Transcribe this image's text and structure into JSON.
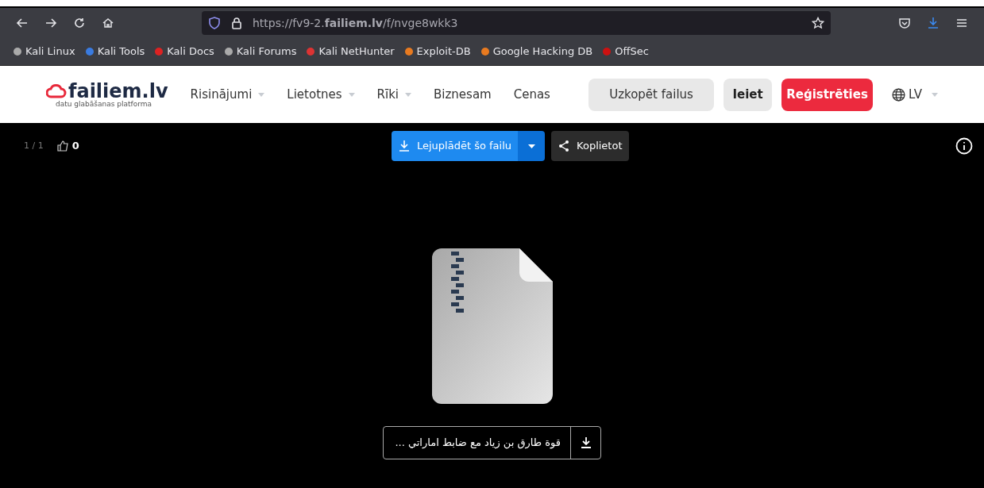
{
  "browser": {
    "url": "https://fv9-2.**failiem.lv**/f/nvge8wkk3",
    "bookmarks": [
      "Kali Linux",
      "Kali Tools",
      "Kali Docs",
      "Kali Forums",
      "Kali NetHunter",
      "Exploit-DB",
      "Google Hacking DB",
      "OffSec"
    ]
  },
  "site_header": {
    "logo": "failiem.lv",
    "tagline": "datu glabāšanas platforma",
    "nav": [
      {
        "label": "Risinājumi",
        "dropdown": true
      },
      {
        "label": "Lietotnes",
        "dropdown": true
      },
      {
        "label": "Rīki",
        "dropdown": true
      },
      {
        "label": "Biznesam",
        "dropdown": false
      },
      {
        "label": "Cenas",
        "dropdown": false
      }
    ],
    "copy_button": "Uzkopēt failus",
    "login_button": "Ieiet",
    "register_button": "Reģistrēties",
    "language": "LV"
  },
  "viewer": {
    "counter": "1 / 1",
    "likes": "0",
    "download_button": "Lejuplādēt šo failu",
    "share_button": "Koplietot",
    "file_name": "قوة طارق بن زياد مع ضابط اماراتي ..."
  }
}
